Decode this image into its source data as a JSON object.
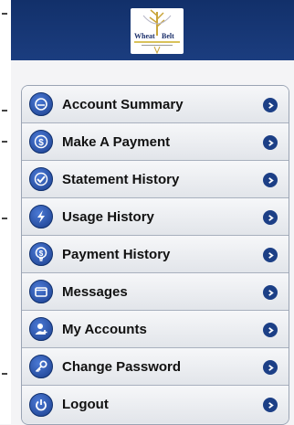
{
  "logo": {
    "text_left": "Wheat",
    "text_right": "Belt"
  },
  "menu": {
    "items": [
      {
        "label": "Account Summary",
        "icon": "speedometer-icon"
      },
      {
        "label": "Make A Payment",
        "icon": "dollar-icon"
      },
      {
        "label": "Statement History",
        "icon": "check-icon"
      },
      {
        "label": "Usage History",
        "icon": "lightning-icon"
      },
      {
        "label": "Payment History",
        "icon": "dollar-bulb-icon"
      },
      {
        "label": "Messages",
        "icon": "envelope-icon"
      },
      {
        "label": "My Accounts",
        "icon": "user-add-icon"
      },
      {
        "label": "Change Password",
        "icon": "key-icon"
      },
      {
        "label": "Logout",
        "icon": "power-icon"
      }
    ]
  },
  "colors": {
    "header": "#12306a",
    "icon": "#1b3e8c",
    "chevron": "#1c3f86"
  }
}
